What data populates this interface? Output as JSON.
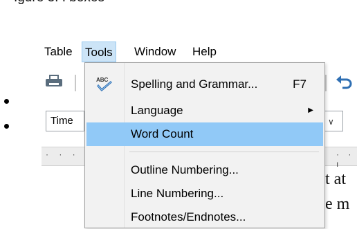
{
  "page_top_text": "Igure 3. I boxes",
  "menubar": {
    "items": [
      {
        "label": "Table"
      },
      {
        "label": "Tools"
      },
      {
        "label": "Window"
      },
      {
        "label": "Help"
      }
    ]
  },
  "toolbar": {
    "font_name": "Time",
    "font_dropdown_chevron": "∨"
  },
  "tools_menu": {
    "items": [
      {
        "label": "Spelling and Grammar...",
        "shortcut": "F7",
        "icon": "spellcheck-icon"
      },
      {
        "label": "Language",
        "submenu": true
      },
      {
        "label": "Word Count",
        "highlighted": true
      },
      {
        "label": "Outline Numbering..."
      },
      {
        "label": "Line Numbering..."
      },
      {
        "label": "Footnotes/Endnotes..."
      }
    ]
  },
  "document": {
    "text_fragment_1": "t at",
    "text_fragment_2": "e m"
  },
  "colors": {
    "menu_background": "#f2f2f2",
    "highlight": "#91c9f7",
    "active_menu": "#cce4f7"
  }
}
